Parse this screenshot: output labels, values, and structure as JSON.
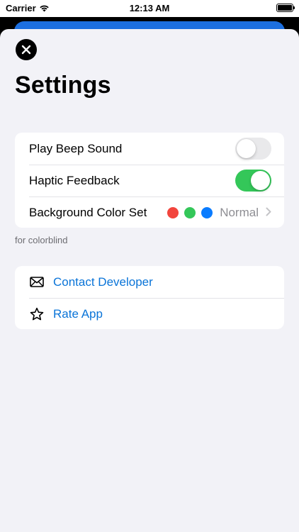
{
  "status_bar": {
    "carrier": "Carrier",
    "time": "12:13 AM"
  },
  "header": {
    "title": "Settings"
  },
  "settings": {
    "play_beep_label": "Play Beep Sound",
    "play_beep_on": false,
    "haptic_label": "Haptic Feedback",
    "haptic_on": true,
    "bg_color_label": "Background Color Set",
    "bg_color_value": "Normal",
    "bg_colors": [
      "#f2453d",
      "#34c759",
      "#0a7cff"
    ],
    "footnote": "for colorblind"
  },
  "links": {
    "contact_label": "Contact Developer",
    "rate_label": "Rate App"
  },
  "colors": {
    "accent": "#0a74d8",
    "toggle_on": "#34c759"
  }
}
